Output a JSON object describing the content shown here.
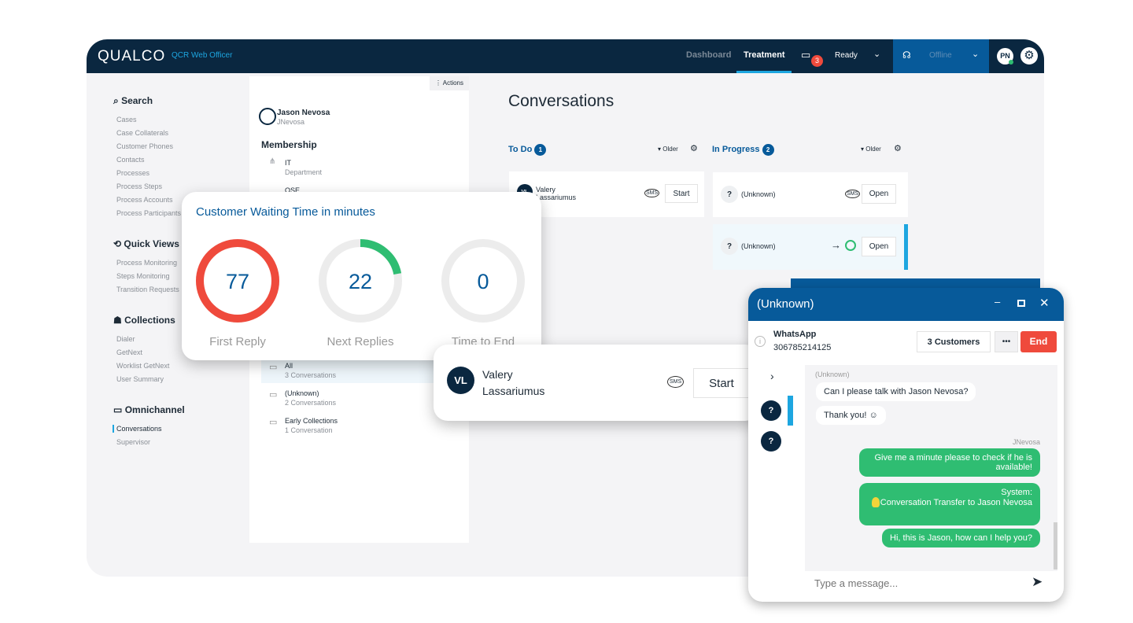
{
  "header": {
    "logo": "QUALCO",
    "app_name": "QCR Web Officer",
    "nav": [
      "Dashboard",
      "Treatment"
    ],
    "active_tab": "Treatment",
    "chat_badge": "3",
    "status": "Ready",
    "phone_status": "Offline",
    "avatar": "PN"
  },
  "sidebar": {
    "sections": [
      {
        "title": "Search",
        "icon": "search-icon",
        "items": [
          "Cases",
          "Case Collaterals",
          "Customer Phones",
          "Contacts",
          "Processes",
          "Process Steps",
          "Process Accounts",
          "Process Participants"
        ]
      },
      {
        "title": "Quick Views",
        "icon": "quick-views-icon",
        "items": [
          "Process Monitoring",
          "Steps Monitoring",
          "Transition Requests"
        ]
      },
      {
        "title": "Collections",
        "icon": "collections-icon",
        "items": [
          "Dialer",
          "GetNext",
          "Worklist GetNext",
          "User Summary"
        ]
      },
      {
        "title": "Omnichannel",
        "icon": "chat-icon",
        "items": [
          "Conversations",
          "Supervisor"
        ]
      }
    ],
    "active": "Conversations"
  },
  "panel": {
    "actions": "Actions",
    "user_name": "Jason Nevosa",
    "user_id": "JNevosa",
    "membership": "Membership",
    "memberships": [
      {
        "name": "IT",
        "type": "Department"
      },
      {
        "name": "OSE",
        "type": ""
      }
    ],
    "groups": [
      {
        "name": "All",
        "count": "3 Conversations"
      },
      {
        "name": "(Unknown)",
        "count": "2 Conversations"
      },
      {
        "name": "Early Collections",
        "count": "1 Conversation"
      }
    ]
  },
  "conversations": {
    "title": "Conversations",
    "sort": "Older",
    "todo": {
      "label": "To Do",
      "count": "1",
      "items": [
        {
          "name": "Valery Lassariumus",
          "initials": "VL",
          "channel": "SMS",
          "action": "Start"
        }
      ]
    },
    "in_progress": {
      "label": "In Progress",
      "count": "2",
      "items": [
        {
          "name": "(Unknown)",
          "channel": "SMS",
          "action": "Open"
        },
        {
          "name": "(Unknown)",
          "channel": "WhatsApp",
          "action": "Open"
        }
      ]
    }
  },
  "waiting_card": {
    "title": "Customer Waiting Time in minutes",
    "gauges": [
      {
        "label": "First Reply",
        "value": 77,
        "fill": 1.0,
        "color": "#ef4a3c"
      },
      {
        "label": "Next Replies",
        "value": 22,
        "fill": 0.22,
        "color": "#2fbd72"
      },
      {
        "label": "Time to End",
        "value": 0,
        "fill": 0,
        "color": "#2fbd72"
      }
    ]
  },
  "popup_card": {
    "initials": "VL",
    "first": "Valery",
    "last": "Lassariumus",
    "channel": "SMS",
    "action": "Start"
  },
  "chat": {
    "title": "(Unknown)",
    "channel": "WhatsApp",
    "phone": "306785214125",
    "customers": "3 Customers",
    "more": "•••",
    "end": "End",
    "in_sender": "(Unknown)",
    "out_sender": "JNevosa",
    "messages_in": [
      "Can I please talk with Jason Nevosa?",
      "Thank you! ☺"
    ],
    "messages_out": [
      "Give me a minute please to check if he is available!",
      "System:\nConversation Transfer to Jason Nevosa",
      "Hi, this is  Jason, how can I help you?"
    ],
    "placeholder": "Type a message..."
  }
}
